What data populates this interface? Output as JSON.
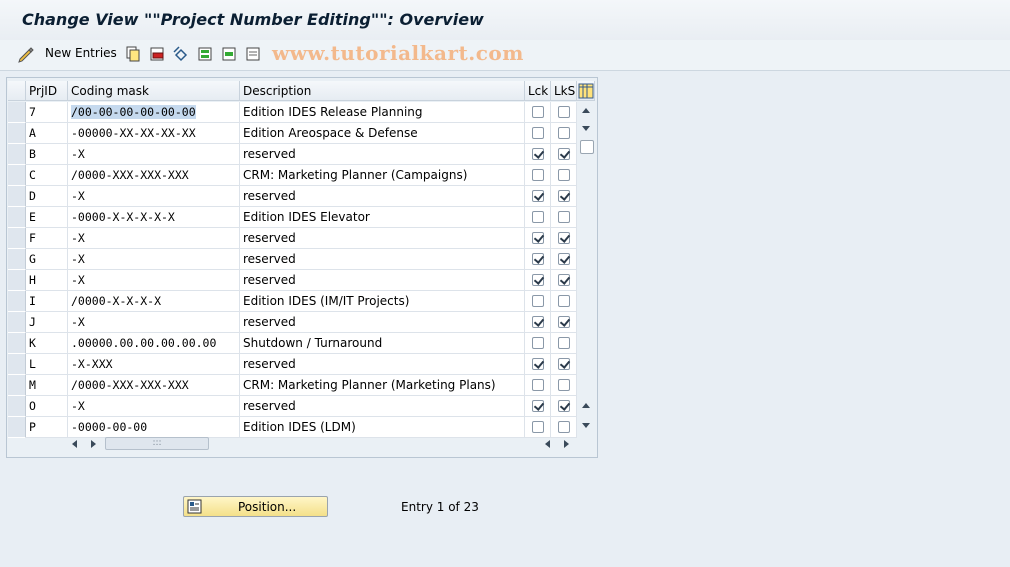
{
  "window": {
    "title": "Change View \"\"Project Number Editing\"\": Overview"
  },
  "toolbar": {
    "new_entries_label": "New Entries",
    "icons": [
      "display-change-icon",
      "copy-icon",
      "delete-icon",
      "undo-icon",
      "select-all-icon",
      "select-block-icon",
      "deselect-icon"
    ],
    "watermark": "www.tutorialkart.com"
  },
  "table": {
    "columns": [
      "PrjID",
      "Coding mask",
      "Description",
      "Lck",
      "LkS"
    ],
    "rows": [
      {
        "prjid": "7",
        "mask": "/00-00-00-00-00-00",
        "desc": "Edition IDES Release Planning",
        "lck": false,
        "lks": false
      },
      {
        "prjid": "A",
        "mask": "-00000-XX-XX-XX-XX",
        "desc": "Edition Areospace & Defense",
        "lck": false,
        "lks": false
      },
      {
        "prjid": "B",
        "mask": "-X",
        "desc": "reserved",
        "lck": true,
        "lks": true
      },
      {
        "prjid": "C",
        "mask": "/0000-XXX-XXX-XXX",
        "desc": "CRM: Marketing Planner (Campaigns)",
        "lck": false,
        "lks": false
      },
      {
        "prjid": "D",
        "mask": "-X",
        "desc": "reserved",
        "lck": true,
        "lks": true
      },
      {
        "prjid": "E",
        "mask": "-0000-X-X-X-X-X",
        "desc": "Edition IDES Elevator",
        "lck": false,
        "lks": false
      },
      {
        "prjid": "F",
        "mask": "-X",
        "desc": "reserved",
        "lck": true,
        "lks": true
      },
      {
        "prjid": "G",
        "mask": "-X",
        "desc": "reserved",
        "lck": true,
        "lks": true
      },
      {
        "prjid": "H",
        "mask": "-X",
        "desc": "reserved",
        "lck": true,
        "lks": true
      },
      {
        "prjid": "I",
        "mask": "/0000-X-X-X-X",
        "desc": "Edition IDES (IM/IT Projects)",
        "lck": false,
        "lks": false
      },
      {
        "prjid": "J",
        "mask": "-X",
        "desc": "reserved",
        "lck": true,
        "lks": true
      },
      {
        "prjid": "K",
        "mask": ".00000.00.00.00.00.00",
        "desc": "Shutdown / Turnaround",
        "lck": false,
        "lks": false
      },
      {
        "prjid": "L",
        "mask": "-X-XXX",
        "desc": "reserved",
        "lck": true,
        "lks": true
      },
      {
        "prjid": "M",
        "mask": "/0000-XXX-XXX-XXX",
        "desc": "CRM: Marketing Planner (Marketing Plans)",
        "lck": false,
        "lks": false
      },
      {
        "prjid": "O",
        "mask": "-X",
        "desc": "reserved",
        "lck": true,
        "lks": true
      },
      {
        "prjid": "P",
        "mask": "-0000-00-00",
        "desc": "Edition IDES (LDM)",
        "lck": false,
        "lks": false
      }
    ]
  },
  "footer": {
    "position_button_label": "Position...",
    "entry_text": "Entry 1 of 23"
  }
}
